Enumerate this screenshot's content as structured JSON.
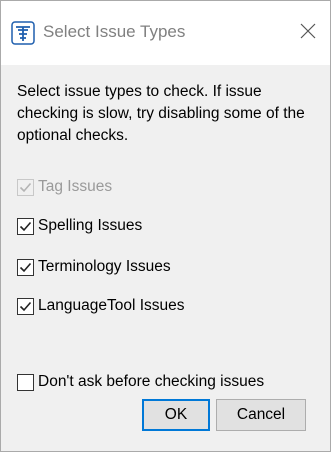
{
  "window": {
    "title": "Select Issue Types",
    "close_glyph": "✕"
  },
  "instructions": "Select issue types to check. If issue checking is slow, try disabling some of the optional checks.",
  "checks": [
    {
      "label": "Tag Issues",
      "checked": true,
      "enabled": false
    },
    {
      "label": "Spelling Issues",
      "checked": true,
      "enabled": true
    },
    {
      "label": "Terminology Issues",
      "checked": true,
      "enabled": true
    },
    {
      "label": "LanguageTool Issues",
      "checked": true,
      "enabled": true
    }
  ],
  "dont_ask": {
    "label": "Don't ask before checking issues",
    "checked": false
  },
  "buttons": {
    "ok": "OK",
    "cancel": "Cancel"
  },
  "colors": {
    "accent": "#0078d7",
    "dialog_bg": "#f0f0f0",
    "disabled_text": "#9a9a9a"
  },
  "icons": {
    "app": "app-logo-icon",
    "close": "close-icon",
    "check": "checkmark-icon"
  }
}
